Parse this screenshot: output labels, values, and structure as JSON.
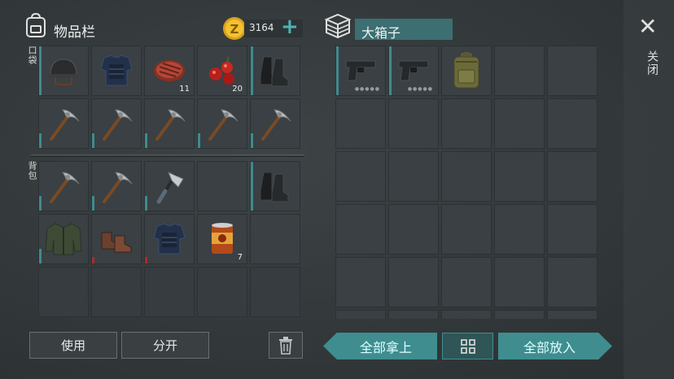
{
  "left_panel": {
    "title": "物品栏",
    "coins": "3164",
    "add_symbol": "+",
    "pocket_label": "口袋",
    "backpack_label": "背包"
  },
  "pocket_items": [
    {
      "name": "helmet-icon",
      "qty": ""
    },
    {
      "name": "body-armor-icon",
      "qty": ""
    },
    {
      "name": "steak-icon",
      "qty": "11"
    },
    {
      "name": "berries-icon",
      "qty": "20"
    },
    {
      "name": "boots-icon",
      "qty": ""
    },
    {
      "name": "pickaxe-icon",
      "qty": ""
    },
    {
      "name": "pickaxe-icon",
      "qty": ""
    },
    {
      "name": "pickaxe-icon",
      "qty": ""
    },
    {
      "name": "pickaxe-icon",
      "qty": ""
    },
    {
      "name": "pickaxe-icon",
      "qty": ""
    }
  ],
  "backpack_items": [
    {
      "name": "pickaxe-icon",
      "qty": ""
    },
    {
      "name": "pickaxe-icon",
      "qty": ""
    },
    {
      "name": "hatchet-icon",
      "qty": ""
    },
    {
      "name": "",
      "qty": ""
    },
    {
      "name": "boots-icon",
      "qty": ""
    },
    {
      "name": "jacket-icon",
      "qty": ""
    },
    {
      "name": "shoes-icon",
      "qty": ""
    },
    {
      "name": "body-armor-icon",
      "qty": ""
    },
    {
      "name": "canned-food-icon",
      "qty": "7"
    },
    {
      "name": "",
      "qty": ""
    },
    {
      "name": "",
      "qty": ""
    },
    {
      "name": "",
      "qty": ""
    },
    {
      "name": "",
      "qty": ""
    },
    {
      "name": "",
      "qty": ""
    },
    {
      "name": "",
      "qty": ""
    }
  ],
  "container": {
    "title": "大箱子",
    "items": [
      {
        "name": "pistol-icon"
      },
      {
        "name": "pistol-icon"
      },
      {
        "name": "backpack-icon"
      }
    ]
  },
  "buttons": {
    "use": "使用",
    "split": "分开",
    "take_all": "全部拿上",
    "put_all": "全部放入",
    "close": "关闭",
    "close_symbol": "✕"
  },
  "colors": {
    "accent": "#3f8d8f",
    "coin": "#d9a21b",
    "durability_low": "#b02a2a"
  }
}
